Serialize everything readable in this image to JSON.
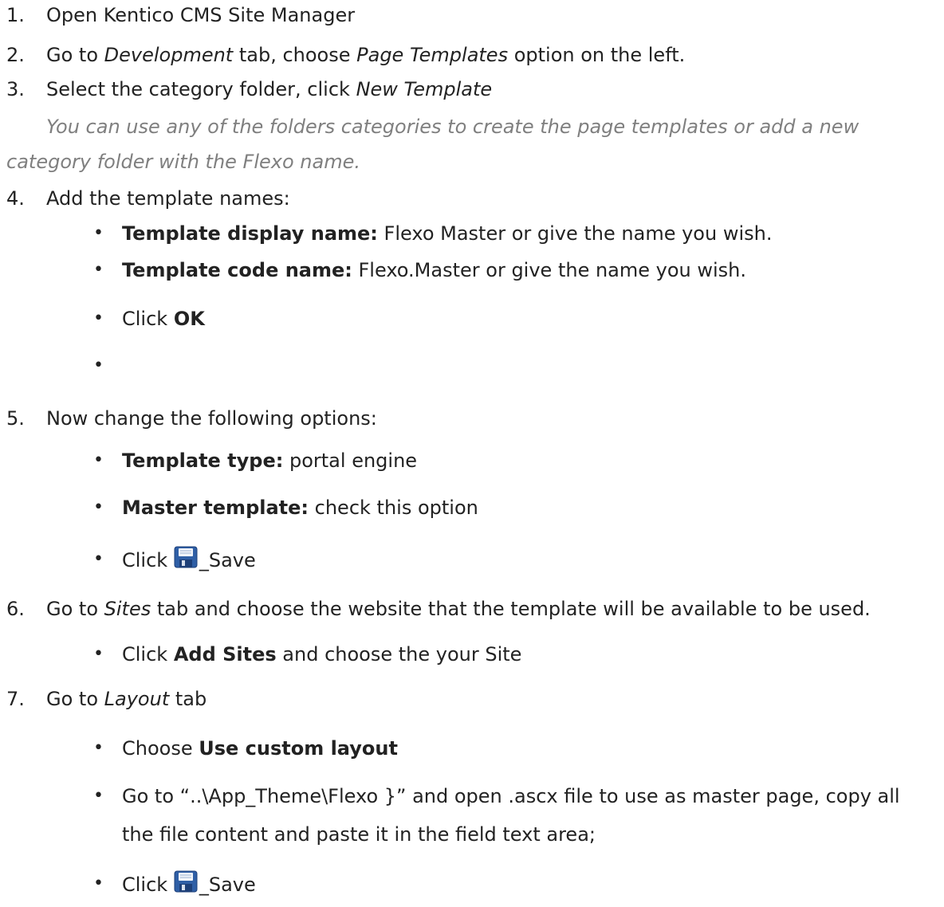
{
  "steps": [
    {
      "num": "1.",
      "text": "Open Kentico CMS Site Manager"
    },
    {
      "num": "2.",
      "pre": "Go to ",
      "em1": "Development",
      "mid": " tab, choose ",
      "em2": "Page Templates",
      "post": " option on the left."
    },
    {
      "num": "3.",
      "pre": "Select the category folder, click ",
      "em": "New Template"
    },
    {
      "num": "4.",
      "text": "Add the template names:"
    },
    {
      "num": "5.",
      "text": "Now change the following options:"
    },
    {
      "num": "6.",
      "pre": "Go to ",
      "em": "Sites",
      "post": " tab and choose the website that the template will be available to be used."
    },
    {
      "num": "7.",
      "pre": "Go to ",
      "em": "Layout",
      "post": " tab"
    }
  ],
  "note": {
    "line1": "You can use any of the folders categories to create the page templates or add a new",
    "line2": "category folder with the Flexo name."
  },
  "bullet_char": "•",
  "step4_items": [
    {
      "label": "Template display name:",
      "text": " Flexo Master or give the name you wish."
    },
    {
      "label": "Template code name:",
      "text": " Flexo.Master or give the name you wish."
    },
    {
      "pre": "Click ",
      "bold": "OK"
    }
  ],
  "step5_items": [
    {
      "label": "Template type:",
      "text": " portal engine"
    },
    {
      "label": "Master template:",
      "text": " check this option"
    },
    {
      "pre": "Click ",
      "icon": "save-icon",
      "post": "_Save"
    }
  ],
  "step6_items": [
    {
      "pre": "Click ",
      "bold": "Add Sites",
      "post": " and choose the your Site"
    }
  ],
  "step7_items": [
    {
      "pre": "Choose ",
      "bold": "Use custom layout"
    },
    {
      "line1": "Go to “..\\App_Theme\\Flexo }” and open .ascx file to use as master page, copy all",
      "line2": "the file content and paste it in the field text area;"
    },
    {
      "pre": "Click ",
      "icon": "save-icon",
      "post": "_Save"
    }
  ],
  "colors": {
    "text": "#222222",
    "note": "#7f7f7f",
    "save_icon_blue": "#2f5fa6"
  }
}
